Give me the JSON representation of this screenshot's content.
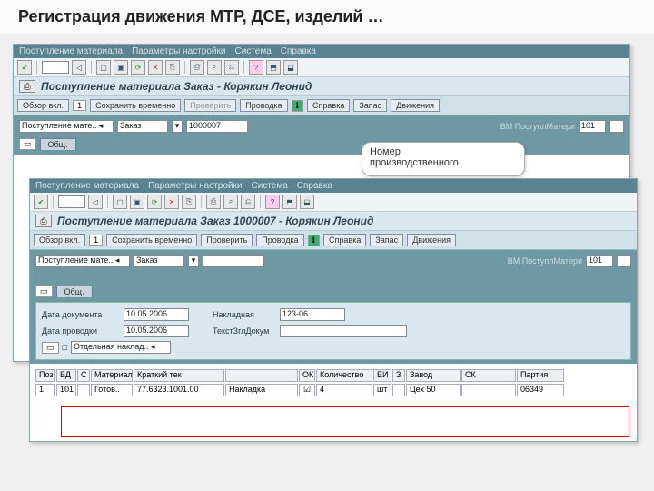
{
  "slide": {
    "title": "Регистрация движения МТР, ДСЕ, изделий …"
  },
  "menu": {
    "items": [
      "Поступление материала",
      "Параметры настройки",
      "Система",
      "Справка"
    ]
  },
  "toolbar_icons": [
    "✔",
    "◁",
    "▢",
    "▣",
    "⟳",
    "✕",
    "⎘",
    "⎙",
    "⌕",
    "⎌",
    "?",
    "⬒",
    "⬓"
  ],
  "back": {
    "title_icon": "⎙",
    "title": "Поступление материала Заказ - Корякин Леонид",
    "cmd": {
      "obzor": "Обзор вкл.",
      "one": "1",
      "sohranit": "Сохранить временно",
      "proverit": "Проверить",
      "provodka": "Проводка",
      "spravka_icon": "ℹ",
      "spravka": "Справка",
      "zapas": "Запас",
      "dvizheniya": "Движения"
    },
    "row1": {
      "lab1": "Поступление мате.. ◂",
      "lab2": "Заказ",
      "drop": "▾",
      "val": "1000007",
      "rightlab": "ВМ ПоступлМатери",
      "rightval": "101"
    }
  },
  "callout": {
    "line1": "Номер",
    "line2": "производственного"
  },
  "front": {
    "title_icon": "⎙",
    "title": "Поступление материала Заказ 1000007 - Корякин Леонид",
    "row1": {
      "lab1": "Поступление мате.. ◂",
      "lab2": "Заказ",
      "drop": "▾",
      "rightlab": "ВМ ПоступлМатери",
      "rightval": "101"
    },
    "tab": "Общ.",
    "doc": {
      "data_doc_l": "Дата документа",
      "data_doc_v": "10.05.2006",
      "nakladnaya_l": "Накладная",
      "nakladnaya_v": "123-06",
      "data_prov_l": "Дата проводки",
      "data_prov_v": "10.05.2006",
      "text_l": "ТекстЗглДокум",
      "chk_l": "Отдельная наклад.. ◂",
      "sq": "□"
    },
    "table": {
      "hdr": [
        "Поз",
        "ВД",
        "С",
        "Материал",
        "Краткий тек",
        "ОК",
        "Количество",
        "ЕИ",
        "З",
        "Завод",
        "СК",
        "Партия"
      ],
      "row": [
        "1",
        "101",
        "",
        "Готов..",
        "77.6323.1001.00",
        "Накладка",
        "☑",
        "4",
        "",
        "шт",
        "Цех 50",
        "",
        "06349"
      ]
    }
  }
}
